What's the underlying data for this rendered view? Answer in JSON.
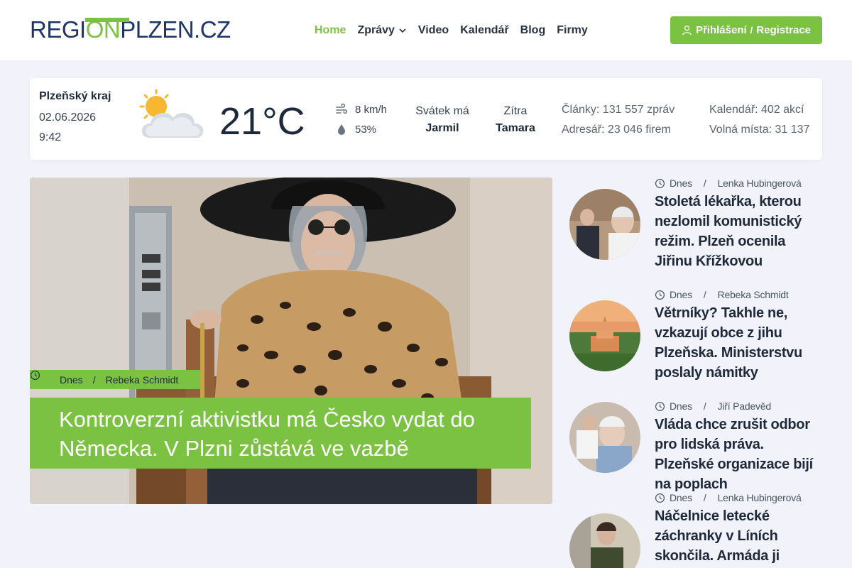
{
  "header": {
    "logo": {
      "part1": "REGI",
      "part2": "ON",
      "part3": "PLZEN.CZ"
    },
    "nav": [
      {
        "label": "Home",
        "active": true
      },
      {
        "label": "Zprávy",
        "has_dropdown": true
      },
      {
        "label": "Video"
      },
      {
        "label": "Kalendář"
      },
      {
        "label": "Blog"
      },
      {
        "label": "Firmy"
      }
    ],
    "login": {
      "login_label": "Přihlášení",
      "separator": "/",
      "register_label": "Registrace",
      "icon": "user-icon"
    }
  },
  "info": {
    "region": "Plzeňský kraj",
    "date": "02.06.2026",
    "time": "9:42",
    "weather_icon": "partly-cloudy-icon",
    "temperature": "21°C",
    "wind": "8 km/h",
    "humidity": "53%",
    "nameday_label": "Svátek má",
    "nameday_name": "Jarmil",
    "tomorrow_label": "Zítra",
    "tomorrow_name": "Tamara",
    "articles": "Články: 131 557 zpráv",
    "directory": "Adresář: 23 046 firem",
    "calendar": "Kalendář: 402 akcí",
    "jobs": "Volná místa: 31 137"
  },
  "hero": {
    "date": "Dnes",
    "separator": "/",
    "author": "Rebeka Schmidt",
    "title": "Kontroverzní aktivistku má Česko vydat do Německa. V Plzni zůstává ve vazbě"
  },
  "side_articles": [
    {
      "date": "Dnes",
      "separator": "/",
      "author": "Lenka Hubingerová",
      "title": "Stoletá lékařka, kterou nezlomil komunistický režim. Plzeň ocenila Jiřinu Křížkovou"
    },
    {
      "date": "Dnes",
      "separator": "/",
      "author": "Rebeka Schmidt",
      "title": "Větrníky? Takhle ne, vzkazují obce z jihu Plzeňska. Ministerstvu poslaly námitky"
    },
    {
      "date": "Dnes",
      "separator": "/",
      "author": "Jiří Padevěd",
      "title": "Vláda chce zrušit odbor pro lidská práva. Plzeňské organizace bijí na poplach"
    },
    {
      "date": "Dnes",
      "separator": "/",
      "author": "Lenka Hubingerová",
      "title": "Náčelnice letecké záchranky v Líních skončila. Armáda ji"
    }
  ],
  "colors": {
    "accent": "#7cc242",
    "navy": "#1e3566",
    "background": "#f2f3fa"
  }
}
